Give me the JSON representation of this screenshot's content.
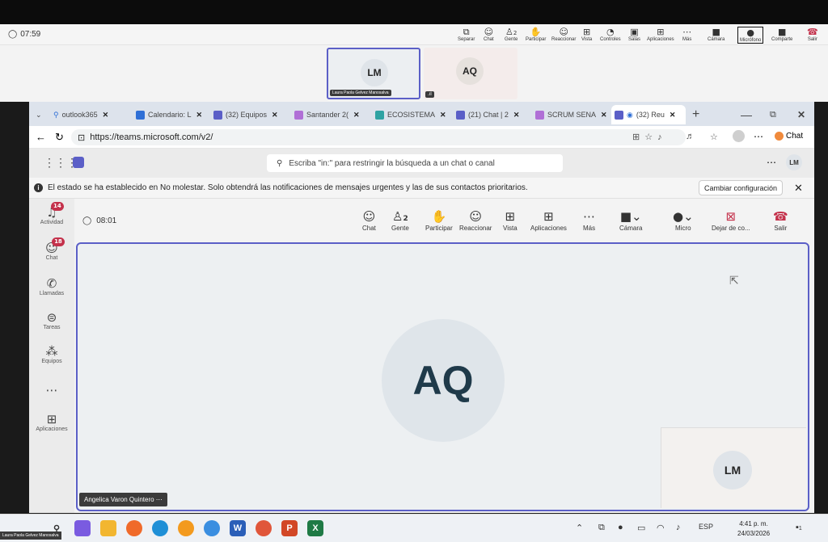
{
  "outer": {
    "timer": "07:59",
    "toolbar": [
      {
        "label": "Separar",
        "icon": "popout-icon"
      },
      {
        "label": "Chat",
        "icon": "chat-icon"
      },
      {
        "label": "Gente",
        "icon": "people-icon",
        "count": "2"
      },
      {
        "label": "Participar",
        "icon": "hand-icon"
      },
      {
        "label": "Reaccionar",
        "icon": "smile-icon"
      },
      {
        "label": "Vista",
        "icon": "grid-icon"
      },
      {
        "label": "Controles",
        "icon": "controls-icon"
      },
      {
        "label": "Salas",
        "icon": "rooms-icon"
      },
      {
        "label": "Aplicaciones",
        "icon": "apps-icon"
      },
      {
        "label": "Más",
        "icon": "more-icon"
      },
      {
        "label": "Cámara",
        "icon": "camera-off-icon"
      },
      {
        "label": "Micrófono",
        "icon": "mic-icon"
      },
      {
        "label": "Comparte",
        "icon": "share-icon"
      },
      {
        "label": "Salir",
        "icon": "leave-icon"
      }
    ],
    "tiles": [
      {
        "initials": "LM",
        "name": "Laura Paola Gelvez Manosalva"
      },
      {
        "initials": "AQ",
        "name": ""
      }
    ]
  },
  "browser": {
    "tabs": [
      {
        "label": "outlook365",
        "color": "#2f6fd6"
      },
      {
        "label": "Calendario: L",
        "color": "#2f6fd6"
      },
      {
        "label": "(32) Equipos",
        "color": "#5b5fc7"
      },
      {
        "label": "Santander 2(",
        "color": "#b06fd6"
      },
      {
        "label": "ECOSISTEMA",
        "color": "#2fa3a3"
      },
      {
        "label": "(21) Chat | 2",
        "color": "#5b5fc7"
      },
      {
        "label": "SCRUM SENA",
        "color": "#b06fd6"
      },
      {
        "label": "(32) Reu",
        "color": "#5b5fc7"
      }
    ],
    "url": "https://teams.microsoft.com/v2/",
    "chat_label": "Chat"
  },
  "teams": {
    "search_placeholder": "Escriba \"in:\" para restringir la búsqueda a un chat o canal",
    "avatar": "LM",
    "notice": "El estado se ha establecido en No molestar. Solo obtendrá las notificaciones de mensajes urgentes y las de sus contactos prioritarios.",
    "notice_button": "Cambiar configuración",
    "rail": [
      {
        "label": "Actividad",
        "icon": "bell-icon",
        "badge": "14"
      },
      {
        "label": "Chat",
        "icon": "chat-icon",
        "badge": "18"
      },
      {
        "label": "Llamadas",
        "icon": "phone-icon",
        "badge": ""
      },
      {
        "label": "Tareas",
        "icon": "tasks-icon",
        "badge": ""
      },
      {
        "label": "Equipos",
        "icon": "teams-icon",
        "badge": ""
      },
      {
        "label": "",
        "icon": "more-icon",
        "badge": ""
      },
      {
        "label": "Aplicaciones",
        "icon": "apps-icon",
        "badge": ""
      }
    ]
  },
  "meeting": {
    "timer": "08:01",
    "people_count": "2",
    "buttons": {
      "chat": "Chat",
      "people": "Gente",
      "raise": "Participar",
      "react": "Reaccionar",
      "view": "Vista",
      "apps": "Aplicaciones",
      "more": "Más",
      "camera": "Cámara",
      "mic": "Micro",
      "stop": "Dejar de co...",
      "leave": "Salir"
    },
    "stage_initials": "AQ",
    "stage_name": "Angelica Varon Quintero",
    "self_initials": "LM"
  },
  "taskbar": {
    "lang": "ESP",
    "time": "4:41 p. m.",
    "date": "24/03/2026",
    "notif": "1",
    "name_overlay": "Laura Paola Gelvez Manosalva"
  },
  "colors": {
    "accent": "#5b5fc7",
    "leave": "#c4314b"
  }
}
